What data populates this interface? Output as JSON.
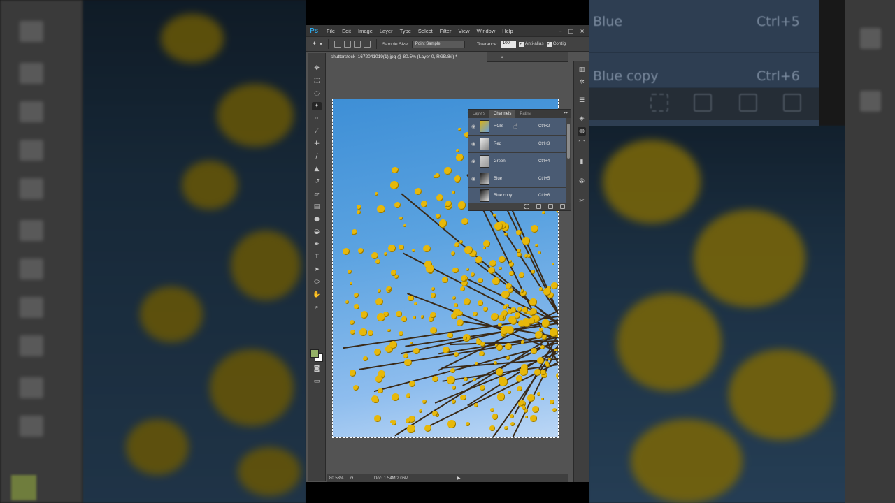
{
  "menubar": {
    "logo": "Ps",
    "items": [
      "File",
      "Edit",
      "Image",
      "Layer",
      "Type",
      "Select",
      "Filter",
      "View",
      "Window",
      "Help"
    ],
    "minimize": "–",
    "maximize": "□",
    "close": "×"
  },
  "options": {
    "sample_size_label": "Sample Size:",
    "sample_size_value": "Point Sample",
    "tolerance_label": "Tolerance:",
    "tolerance_value": "100",
    "anti_alias_label": "Anti-alias",
    "contiguous_label": "Contig"
  },
  "document": {
    "tab_title": "shutterstock_1672041019(1).jpg @ 80.5% (Layer 0, RGB/8#) *",
    "tab_close": "×"
  },
  "status": {
    "zoom": "80.53%",
    "doc": "Doc: 1.54M/2.06M"
  },
  "channels_panel": {
    "tabs": [
      "Layers",
      "Channels",
      "Paths"
    ],
    "active_tab": "Channels",
    "menu": "▸▸",
    "rows": [
      {
        "name": "RGB",
        "shortcut": "Ctrl+2"
      },
      {
        "name": "Red",
        "shortcut": "Ctrl+3"
      },
      {
        "name": "Green",
        "shortcut": "Ctrl+4"
      },
      {
        "name": "Blue",
        "shortcut": "Ctrl+5"
      },
      {
        "name": "Blue copy",
        "shortcut": "Ctrl+6"
      }
    ]
  },
  "backdrop_right": {
    "row1_name": "Blue",
    "row1_key": "Ctrl+5",
    "row2_name": "Blue copy",
    "row2_key": "Ctrl+6"
  },
  "colors": {
    "foreground": "#94b067",
    "background": "#ffffff",
    "ps_logo": "#2fa8e6",
    "selected_row": "#4a5b73"
  },
  "icons": {
    "eye": "eye-icon",
    "move": "move-icon",
    "magic_wand": "magic-wand-icon"
  }
}
